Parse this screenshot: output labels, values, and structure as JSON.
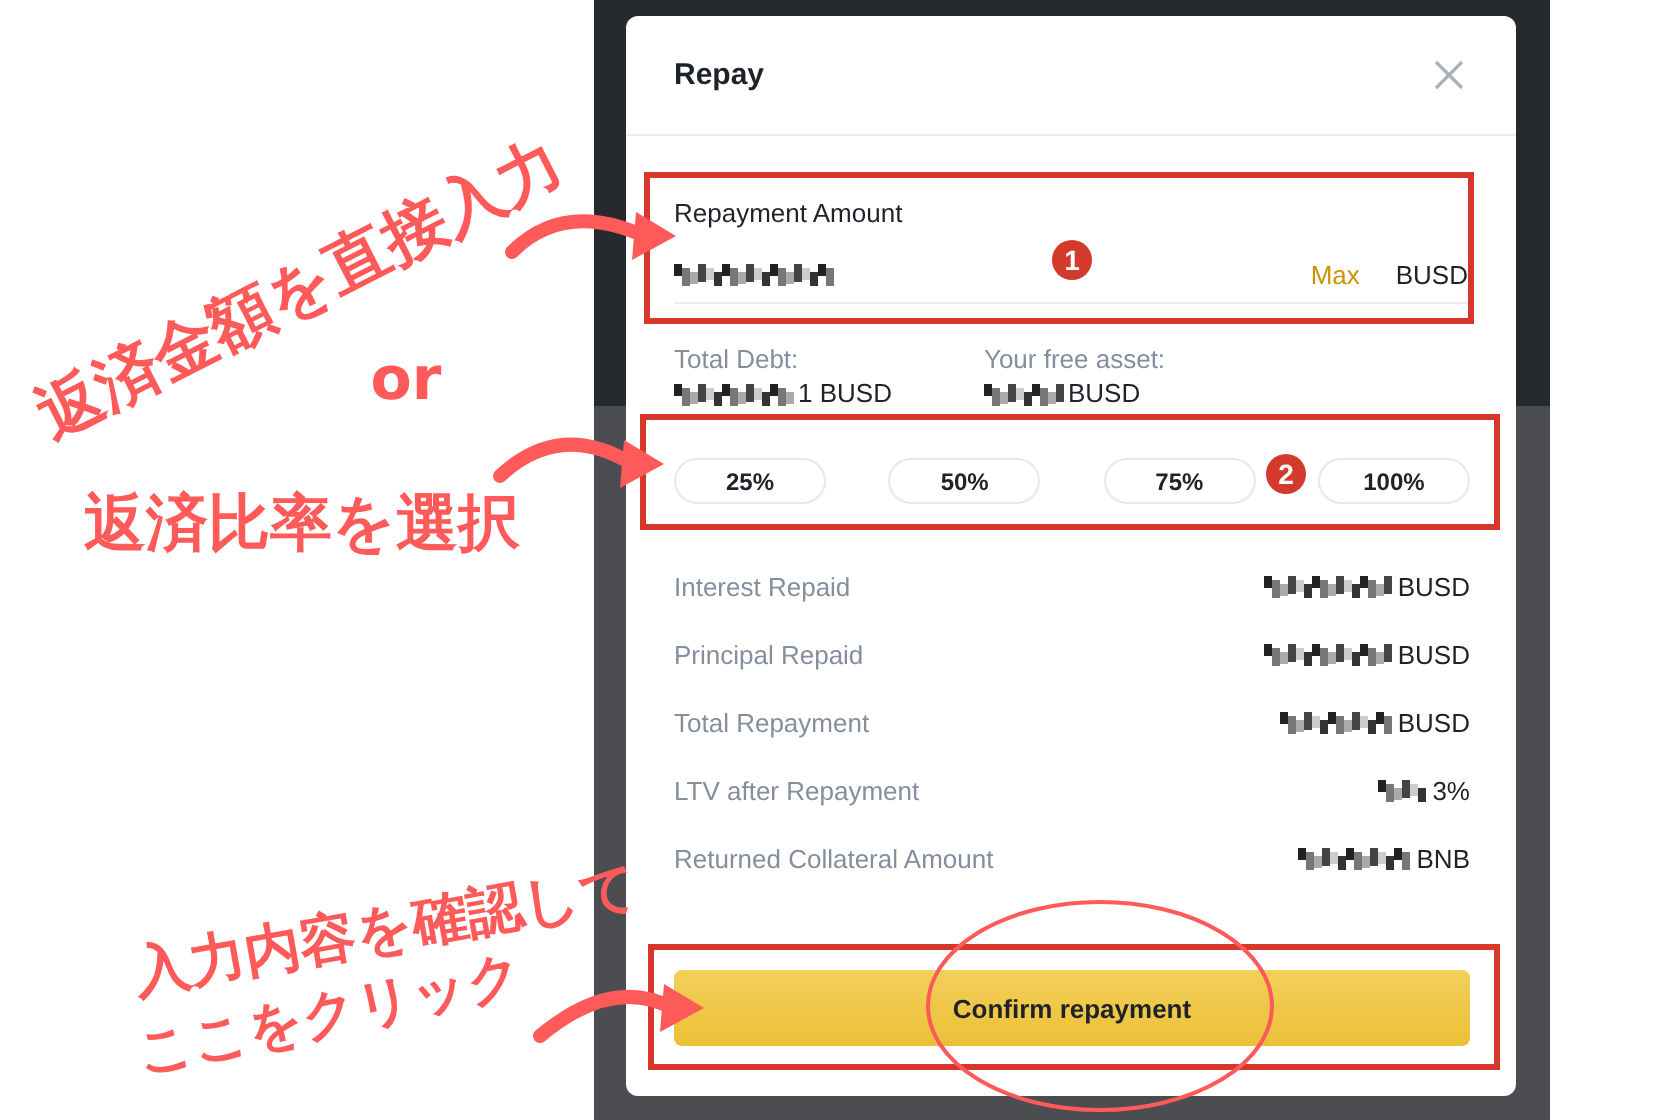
{
  "modal": {
    "title": "Repay",
    "amount_field": {
      "label": "Repayment Amount",
      "max": "Max",
      "unit": "BUSD"
    },
    "balances": [
      {
        "label": "Total Debt:",
        "value": "1 BUSD"
      },
      {
        "label": "Your free asset:",
        "value": "BUSD"
      }
    ],
    "percent_options": [
      "25%",
      "50%",
      "75%",
      "100%"
    ],
    "details": [
      {
        "label": "Interest Repaid",
        "value": "BUSD"
      },
      {
        "label": "Principal Repaid",
        "value": "BUSD"
      },
      {
        "label": "Total Repayment",
        "value": "BUSD"
      },
      {
        "label": "LTV after Repayment",
        "value": "3%"
      },
      {
        "label": "Returned Collateral Amount",
        "value": "BNB"
      }
    ],
    "confirm_button": "Confirm repayment"
  },
  "annotations": {
    "step_badges": [
      "1",
      "2"
    ],
    "notes": [
      "返済金額を直接入力",
      "or",
      "返済比率を選択",
      "入力内容を確認して",
      "ここをクリック"
    ]
  }
}
